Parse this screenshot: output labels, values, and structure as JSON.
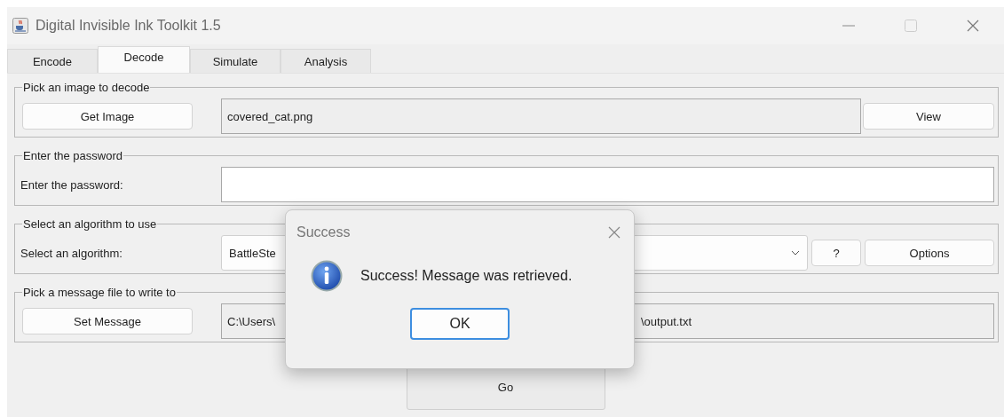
{
  "window": {
    "title": "Digital Invisible Ink Toolkit 1.5"
  },
  "tabs": [
    {
      "label": "Encode",
      "selected": false
    },
    {
      "label": "Decode",
      "selected": true
    },
    {
      "label": "Simulate",
      "selected": false
    },
    {
      "label": "Analysis",
      "selected": false
    }
  ],
  "groups": [
    {
      "kind": "file",
      "title": "Pick an image to decode",
      "button": "Get Image",
      "value": "covered_cat.png",
      "side_button": "View"
    },
    {
      "kind": "password",
      "title": "Enter the password",
      "label": "Enter the password:"
    },
    {
      "kind": "select",
      "title": "Select an algorithm to use",
      "label": "Select an algorithm:",
      "value": "BattleSte",
      "buttons": [
        "?",
        "Options"
      ]
    },
    {
      "kind": "file",
      "title": "Pick a message file to write to",
      "button": "Set Message",
      "value": "C:\\Users\\",
      "value_end": "\\output.txt"
    }
  ],
  "go_button": "Go",
  "dialog": {
    "title": "Success",
    "message": "Success! Message was retrieved.",
    "button": "OK"
  }
}
